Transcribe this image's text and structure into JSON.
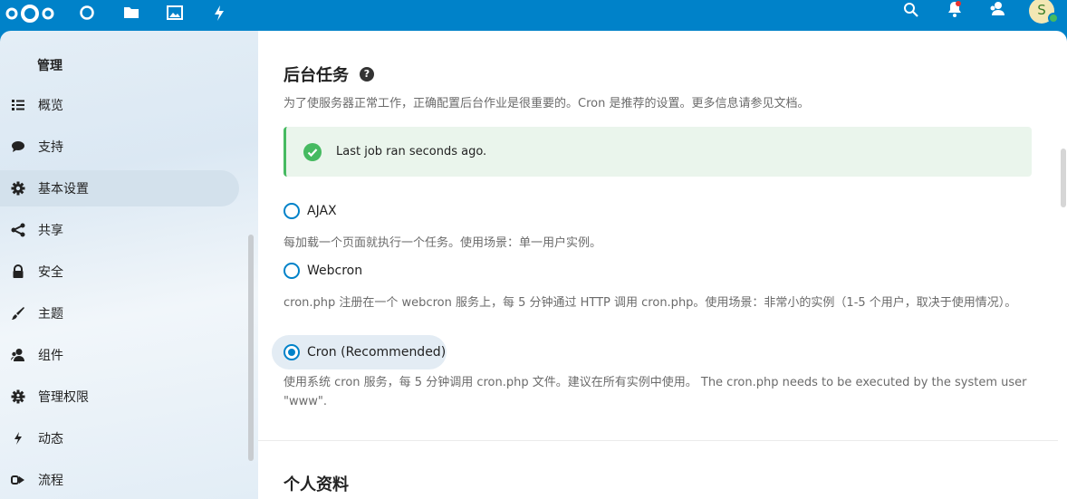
{
  "header": {
    "apps": [
      "logo-icon",
      "dashboard-icon",
      "files-icon",
      "photos-icon",
      "activity-icon"
    ],
    "avatar_initial": "S",
    "icons": [
      "search-icon",
      "notifications-icon",
      "contacts-icon"
    ]
  },
  "sidebar": {
    "heading": "管理",
    "items": [
      {
        "label": "概览",
        "icon": "list-icon"
      },
      {
        "label": "支持",
        "icon": "chat-bubble-icon"
      },
      {
        "label": "基本设置",
        "icon": "gear-icon",
        "active": true
      },
      {
        "label": "共享",
        "icon": "share-icon"
      },
      {
        "label": "安全",
        "icon": "lock-icon"
      },
      {
        "label": "主题",
        "icon": "paintbrush-icon"
      },
      {
        "label": "组件",
        "icon": "user-group-icon"
      },
      {
        "label": "管理权限",
        "icon": "admin-gear-icon"
      },
      {
        "label": "动态",
        "icon": "lightning-icon"
      },
      {
        "label": "流程",
        "icon": "flow-icon"
      }
    ]
  },
  "main": {
    "section_title": "后台任务",
    "section_desc": "为了使服务器正常工作，正确配置后台作业是很重要的。Cron 是推荐的设置。更多信息请参见文档。",
    "notice": "Last job ran seconds ago.",
    "options": [
      {
        "label": "AJAX",
        "desc": "每加载一个页面就执行一个任务。使用场景：单一用户实例。",
        "checked": false
      },
      {
        "label": "Webcron",
        "desc": "cron.php 注册在一个 webcron 服务上，每 5 分钟通过 HTTP 调用 cron.php。使用场景：非常小的实例（1-5 个用户，取决于使用情况）。",
        "checked": false
      },
      {
        "label": "Cron (Recommended)",
        "desc": "使用系统 cron 服务，每 5 分钟调用 cron.php 文件。建议在所有实例中使用。 The cron.php needs to be executed by the system user \"www\".",
        "checked": true
      }
    ],
    "next_section_title": "个人资料"
  },
  "colors": {
    "accent": "#0082c9",
    "success": "#46ba61"
  }
}
